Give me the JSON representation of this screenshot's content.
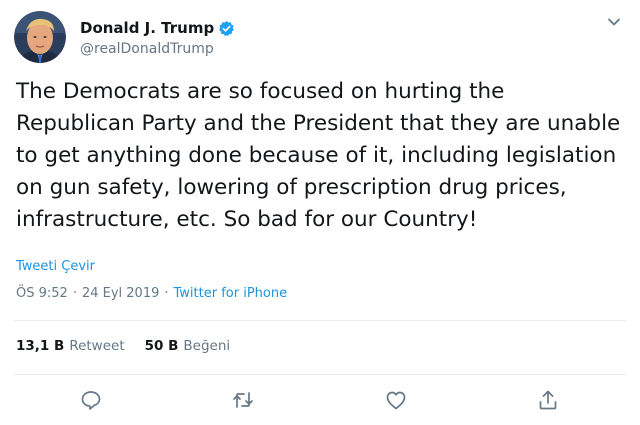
{
  "author": {
    "display_name": "Donald J. Trump",
    "handle": "@realDonaldTrump",
    "verified": true
  },
  "tweet": {
    "text": "The Democrats are so focused on hurting the\nRepublican Party and the President that they are unable\nto get anything done because of it, including legislation\non gun safety, lowering of prescription drug prices,\ninfrastructure, etc. So bad for our Country!",
    "translate_label": "Tweeti Çevir",
    "time": "ÖS 9:52",
    "separator": "·",
    "date": "24 Eyl 2019",
    "source": "Twitter for iPhone"
  },
  "stats": {
    "retweets_count": "13,1 B",
    "retweets_label": "Retweet",
    "likes_count": "50 B",
    "likes_label": "Beğeni"
  },
  "icons": {
    "verified": "verified-badge-icon",
    "caret": "chevron-down-icon",
    "reply": "reply-icon",
    "retweet": "retweet-icon",
    "like": "heart-icon",
    "share": "share-icon"
  },
  "colors": {
    "link": "#1b95e0",
    "muted": "#657786",
    "text": "#14171a",
    "verified": "#1da1f2",
    "divider": "#e6ecf0"
  }
}
